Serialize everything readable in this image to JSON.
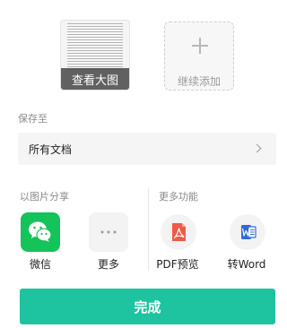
{
  "preview": {
    "caption": "查看大图"
  },
  "add_more": {
    "label": "继续添加"
  },
  "save_to": {
    "label": "保存至",
    "folder": "所有文档"
  },
  "share_image": {
    "title": "以图片分享",
    "items": [
      {
        "label": "微信",
        "icon": "wechat-icon",
        "color": "#14c35a"
      },
      {
        "label": "更多",
        "icon": "more-dots-icon"
      }
    ]
  },
  "more_functions": {
    "title": "更多功能",
    "items": [
      {
        "label": "PDF预览",
        "icon": "pdf-icon",
        "color": "#f05a46"
      },
      {
        "label": "转Word",
        "icon": "word-icon",
        "color": "#2f6bd8"
      }
    ]
  },
  "done": {
    "label": "完成",
    "color": "#1ec3a0"
  }
}
